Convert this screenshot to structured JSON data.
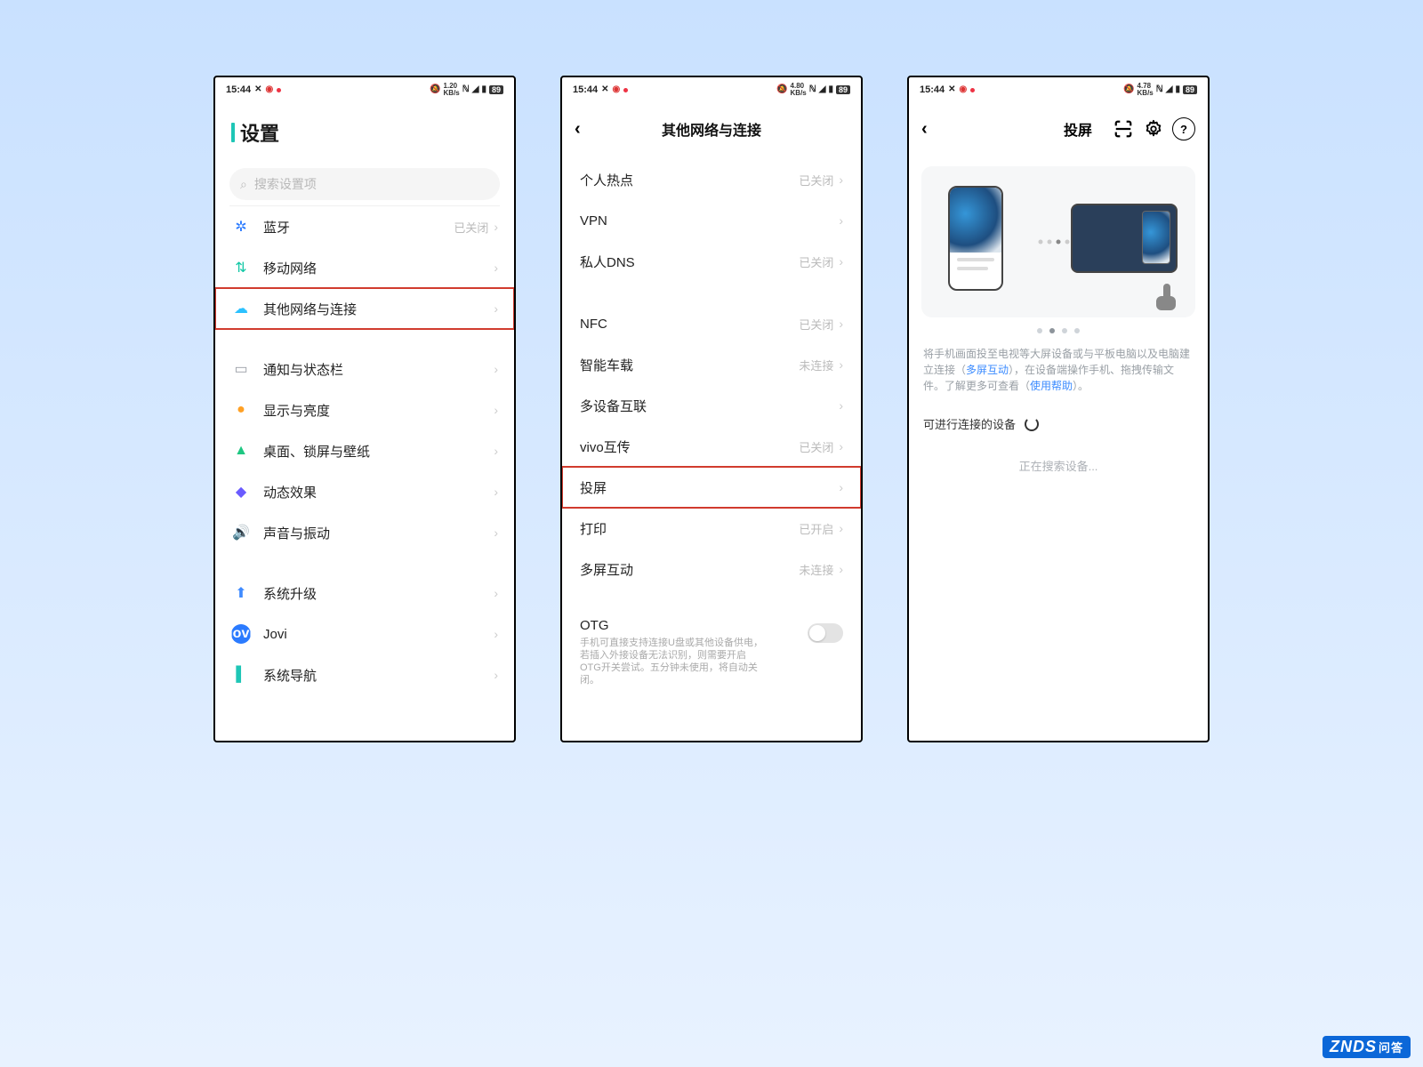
{
  "status_bar": {
    "time": "15:44",
    "speed1": "1.20",
    "speed2": "4.80",
    "speed3": "4.78",
    "speed_unit": "KB/s",
    "battery": "89"
  },
  "screen1": {
    "title": "设置",
    "search_placeholder": "搜索设置项",
    "items_a": [
      {
        "icon": "bt",
        "label": "蓝牙",
        "status": "已关闭"
      },
      {
        "icon": "net",
        "label": "移动网络",
        "status": ""
      },
      {
        "icon": "other",
        "label": "其他网络与连接",
        "status": "",
        "highlight": true
      }
    ],
    "items_b": [
      {
        "icon": "notif",
        "label": "通知与状态栏"
      },
      {
        "icon": "display",
        "label": "显示与亮度"
      },
      {
        "icon": "wall",
        "label": "桌面、锁屏与壁纸"
      },
      {
        "icon": "motion",
        "label": "动态效果"
      },
      {
        "icon": "sound",
        "label": "声音与振动"
      }
    ],
    "items_c": [
      {
        "icon": "upgrade",
        "label": "系统升级"
      },
      {
        "icon": "jovi",
        "label": "Jovi"
      },
      {
        "icon": "nav",
        "label": "系统导航"
      }
    ]
  },
  "screen2": {
    "title": "其他网络与连接",
    "group1": [
      {
        "label": "个人热点",
        "status": "已关闭"
      },
      {
        "label": "VPN",
        "status": ""
      },
      {
        "label": "私人DNS",
        "status": "已关闭"
      }
    ],
    "group2": [
      {
        "label": "NFC",
        "status": "已关闭"
      },
      {
        "label": "智能车载",
        "status": "未连接"
      },
      {
        "label": "多设备互联",
        "status": ""
      },
      {
        "label": "vivo互传",
        "status": "已关闭"
      },
      {
        "label": "投屏",
        "status": "",
        "highlight": true
      },
      {
        "label": "打印",
        "status": "已开启"
      },
      {
        "label": "多屏互动",
        "status": "未连接"
      }
    ],
    "otg_title": "OTG",
    "otg_desc": "手机可直接支持连接U盘或其他设备供电，若插入外接设备无法识别，则需要开启OTG开关尝试。五分钟未使用，将自动关闭。"
  },
  "screen3": {
    "title": "投屏",
    "desc_pre": "将手机画面投至电视等大屏设备或与平板电脑以及电脑建立连接（",
    "link1": "多屏互动",
    "desc_mid": "），在设备端操作手机、拖拽传输文件。了解更多可查看（",
    "link2": "使用帮助",
    "desc_post": "）。",
    "devices_label": "可进行连接的设备",
    "searching": "正在搜索设备..."
  },
  "watermark": {
    "brand": "ZNDS",
    "sub": "问答"
  }
}
